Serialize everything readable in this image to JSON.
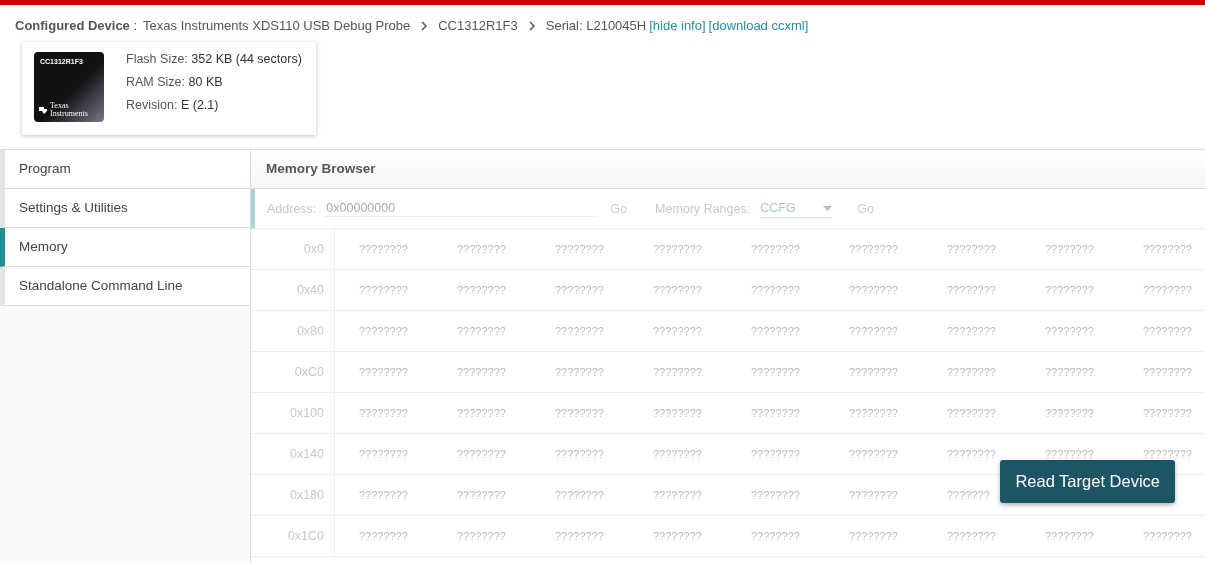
{
  "header": {
    "label": "Configured Device",
    "separator": ":",
    "crumbs": [
      "Texas Instruments XDS110 USB Debug Probe",
      "CC1312R1F3",
      "Serial: L210045H"
    ],
    "links": [
      "[hide info]",
      "[download ccxml]"
    ]
  },
  "device": {
    "chip_label": "CC1312R1F3",
    "logo_text": [
      "Texas",
      "Instruments"
    ],
    "specs": [
      {
        "label": "Flash Size:",
        "value": "352 KB (44 sectors)"
      },
      {
        "label": "RAM Size:",
        "value": "80 KB"
      },
      {
        "label": "Revision:",
        "value": "E (2.1)"
      }
    ]
  },
  "sidebar": {
    "items": [
      {
        "label": "Program",
        "selected": false
      },
      {
        "label": "Settings & Utilities",
        "selected": false
      },
      {
        "label": "Memory",
        "selected": true
      },
      {
        "label": "Standalone Command Line",
        "selected": false
      }
    ]
  },
  "memory_browser": {
    "title": "Memory Browser",
    "address_label": "Address:",
    "address_placeholder": "0x00000000",
    "go_1": "Go",
    "ranges_label": "Memory Ranges:",
    "range_value": "CCFG",
    "go_2": "Go",
    "rows": [
      {
        "address": "0x0",
        "cells": [
          "????????",
          "????????",
          "????????",
          "????????",
          "????????",
          "????????",
          "????????",
          "????????",
          "????????"
        ]
      },
      {
        "address": "0x40",
        "cells": [
          "????????",
          "????????",
          "????????",
          "????????",
          "????????",
          "????????",
          "????????",
          "????????",
          "????????"
        ]
      },
      {
        "address": "0x80",
        "cells": [
          "????????",
          "????????",
          "????????",
          "????????",
          "????????",
          "????????",
          "????????",
          "????????",
          "????????"
        ]
      },
      {
        "address": "0xC0",
        "cells": [
          "????????",
          "????????",
          "????????",
          "????????",
          "????????",
          "????????",
          "????????",
          "????????",
          "????????"
        ]
      },
      {
        "address": "0x100",
        "cells": [
          "????????",
          "????????",
          "????????",
          "????????",
          "????????",
          "????????",
          "????????",
          "????????",
          "????????"
        ]
      },
      {
        "address": "0x140",
        "cells": [
          "????????",
          "????????",
          "????????",
          "????????",
          "????????",
          "????????",
          "????????",
          "????????",
          "????????"
        ]
      },
      {
        "address": "0x180",
        "cells": [
          "????????",
          "????????",
          "????????",
          "????????",
          "????????",
          "????????",
          "???????",
          null,
          null
        ]
      },
      {
        "address": "0x1C0",
        "cells": [
          "????????",
          "????????",
          "????????",
          "????????",
          "????????",
          "????????",
          "????????",
          "????????",
          "????????"
        ]
      }
    ],
    "action_button": "Read Target Device"
  }
}
